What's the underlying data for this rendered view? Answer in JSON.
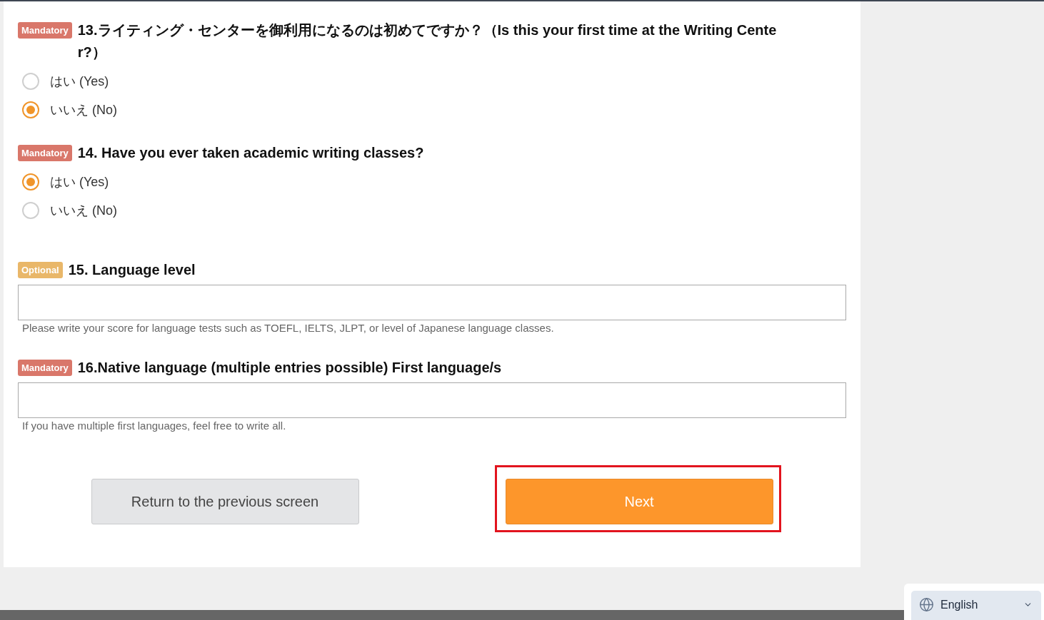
{
  "questions": [
    {
      "kind": "radio",
      "badge": {
        "kind": "mandatory",
        "label": "Mandatory"
      },
      "title": "13.ライティング・センターを御利用になるのは初めてですか？（Is this your first time at the Writing Center?）",
      "options": [
        {
          "label": "はい (Yes)",
          "selected": false
        },
        {
          "label": "いいえ (No)",
          "selected": true
        }
      ]
    },
    {
      "kind": "radio",
      "badge": {
        "kind": "mandatory",
        "label": "Mandatory"
      },
      "title": "14. Have you ever taken academic writing classes?",
      "options": [
        {
          "label": "はい (Yes)",
          "selected": true
        },
        {
          "label": "いいえ (No)",
          "selected": false
        }
      ]
    },
    {
      "kind": "text",
      "badge": {
        "kind": "optional",
        "label": "Optional"
      },
      "title": "15. Language level",
      "hint": "Please write your score for language tests such as TOEFL, IELTS, JLPT, or level of Japanese language classes."
    },
    {
      "kind": "text",
      "badge": {
        "kind": "mandatory",
        "label": "Mandatory"
      },
      "title": "16.Native language (multiple entries possible) First language/s",
      "hint": "If you have multiple first languages, feel free to write all."
    }
  ],
  "buttons": [
    {
      "kind": "secondary",
      "label": "Return to the previous screen",
      "highlighted": false
    },
    {
      "kind": "primary",
      "label": "Next",
      "highlighted": true
    }
  ],
  "language_selector": {
    "value": "English"
  }
}
